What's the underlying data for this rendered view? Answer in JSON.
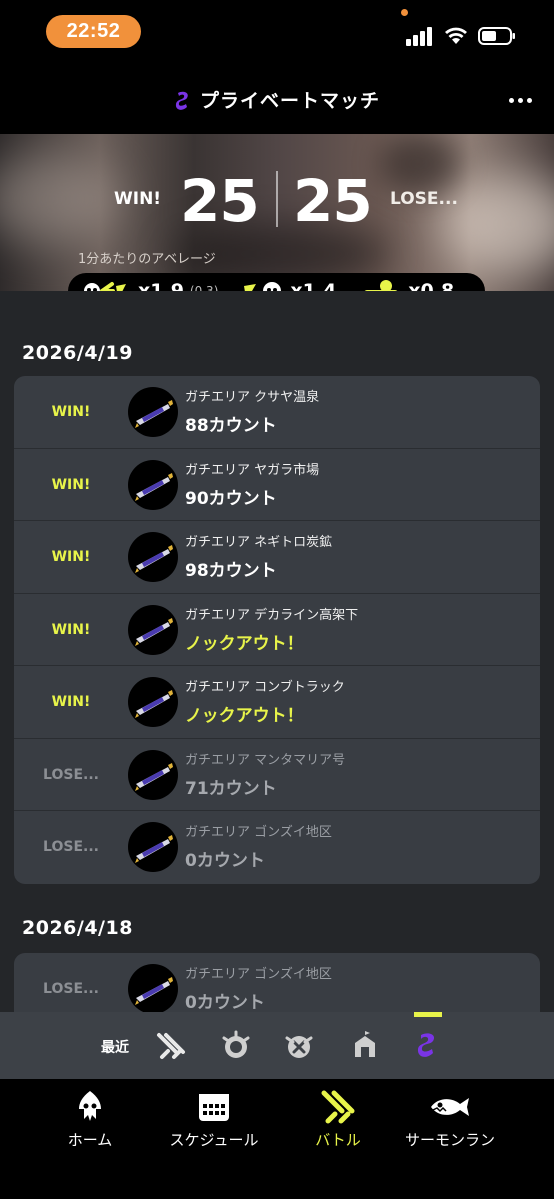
{
  "status_bar": {
    "time": "22:52"
  },
  "header": {
    "title": "プライベートマッチ"
  },
  "hero": {
    "win_label": "WIN!",
    "lose_label": "LOSE...",
    "win_score": "25",
    "lose_score": "25",
    "avg_label": "1分あたりのアベレージ",
    "stats": [
      {
        "icon": "splat-assist-icon",
        "value": "x1.9",
        "sub": "(0.3)"
      },
      {
        "icon": "splatted-icon",
        "value": "x1.4"
      },
      {
        "icon": "special-icon",
        "value": "x0.8"
      }
    ]
  },
  "sections": [
    {
      "date": "2026/4/19",
      "matches": [
        {
          "result": "WIN!",
          "stage": "ガチエリア クサヤ温泉",
          "score": "88カウント",
          "win": true,
          "ko": false
        },
        {
          "result": "WIN!",
          "stage": "ガチエリア ヤガラ市場",
          "score": "90カウント",
          "win": true,
          "ko": false
        },
        {
          "result": "WIN!",
          "stage": "ガチエリア ネギトロ炭鉱",
          "score": "98カウント",
          "win": true,
          "ko": false
        },
        {
          "result": "WIN!",
          "stage": "ガチエリア デカライン高架下",
          "score": "ノックアウト！",
          "win": true,
          "ko": true
        },
        {
          "result": "WIN!",
          "stage": "ガチエリア コンブトラック",
          "score": "ノックアウト！",
          "win": true,
          "ko": true
        },
        {
          "result": "LOSE...",
          "stage": "ガチエリア マンタマリア号",
          "score": "71カウント",
          "win": false,
          "ko": false
        },
        {
          "result": "LOSE...",
          "stage": "ガチエリア ゴンズイ地区",
          "score": "0カウント",
          "win": false,
          "ko": false
        }
      ]
    },
    {
      "date": "2026/4/18",
      "matches": [
        {
          "result": "LOSE...",
          "stage": "ガチエリア ゴンズイ地区",
          "score": "0カウント",
          "win": false,
          "ko": false
        }
      ]
    }
  ],
  "filter_bar": {
    "label": "最近",
    "filters": [
      {
        "icon": "regular-battle-icon"
      },
      {
        "icon": "anarchy-battle-icon"
      },
      {
        "icon": "x-battle-icon"
      },
      {
        "icon": "event-battle-icon"
      },
      {
        "icon": "private-battle-icon",
        "active": true
      }
    ]
  },
  "tabs": [
    {
      "label": "ホーム",
      "icon": "squid-home-icon"
    },
    {
      "label": "スケジュール",
      "icon": "calendar-icon"
    },
    {
      "label": "バトル",
      "icon": "battle-icon",
      "active": true
    },
    {
      "label": "サーモンラン",
      "icon": "salmon-icon"
    }
  ],
  "colors": {
    "accent_yellow": "#e8f44a",
    "purple": "#7a34e6",
    "time_pill": "#f1913b"
  }
}
